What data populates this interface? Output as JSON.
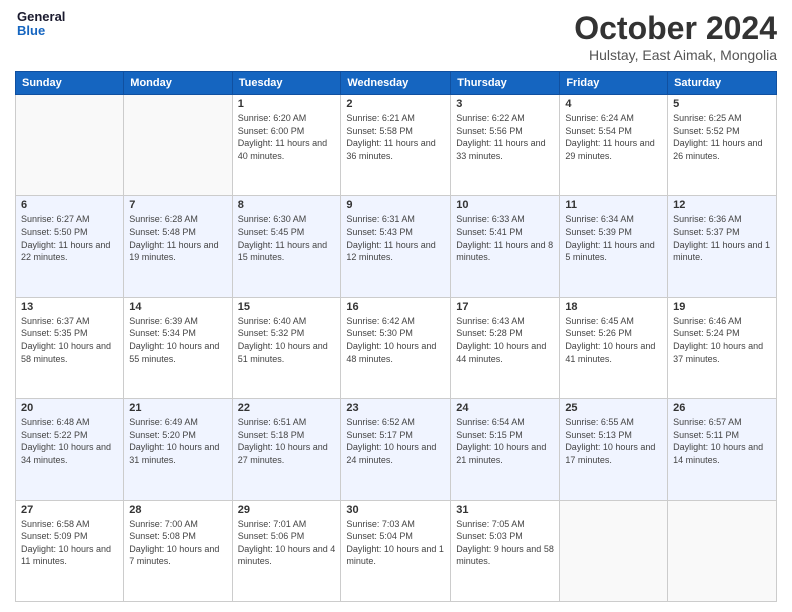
{
  "header": {
    "logo_general": "General",
    "logo_blue": "Blue",
    "month": "October 2024",
    "location": "Hulstay, East Aimak, Mongolia"
  },
  "days_of_week": [
    "Sunday",
    "Monday",
    "Tuesday",
    "Wednesday",
    "Thursday",
    "Friday",
    "Saturday"
  ],
  "weeks": [
    [
      {
        "num": "",
        "info": ""
      },
      {
        "num": "",
        "info": ""
      },
      {
        "num": "1",
        "info": "Sunrise: 6:20 AM\nSunset: 6:00 PM\nDaylight: 11 hours and 40 minutes."
      },
      {
        "num": "2",
        "info": "Sunrise: 6:21 AM\nSunset: 5:58 PM\nDaylight: 11 hours and 36 minutes."
      },
      {
        "num": "3",
        "info": "Sunrise: 6:22 AM\nSunset: 5:56 PM\nDaylight: 11 hours and 33 minutes."
      },
      {
        "num": "4",
        "info": "Sunrise: 6:24 AM\nSunset: 5:54 PM\nDaylight: 11 hours and 29 minutes."
      },
      {
        "num": "5",
        "info": "Sunrise: 6:25 AM\nSunset: 5:52 PM\nDaylight: 11 hours and 26 minutes."
      }
    ],
    [
      {
        "num": "6",
        "info": "Sunrise: 6:27 AM\nSunset: 5:50 PM\nDaylight: 11 hours and 22 minutes."
      },
      {
        "num": "7",
        "info": "Sunrise: 6:28 AM\nSunset: 5:48 PM\nDaylight: 11 hours and 19 minutes."
      },
      {
        "num": "8",
        "info": "Sunrise: 6:30 AM\nSunset: 5:45 PM\nDaylight: 11 hours and 15 minutes."
      },
      {
        "num": "9",
        "info": "Sunrise: 6:31 AM\nSunset: 5:43 PM\nDaylight: 11 hours and 12 minutes."
      },
      {
        "num": "10",
        "info": "Sunrise: 6:33 AM\nSunset: 5:41 PM\nDaylight: 11 hours and 8 minutes."
      },
      {
        "num": "11",
        "info": "Sunrise: 6:34 AM\nSunset: 5:39 PM\nDaylight: 11 hours and 5 minutes."
      },
      {
        "num": "12",
        "info": "Sunrise: 6:36 AM\nSunset: 5:37 PM\nDaylight: 11 hours and 1 minute."
      }
    ],
    [
      {
        "num": "13",
        "info": "Sunrise: 6:37 AM\nSunset: 5:35 PM\nDaylight: 10 hours and 58 minutes."
      },
      {
        "num": "14",
        "info": "Sunrise: 6:39 AM\nSunset: 5:34 PM\nDaylight: 10 hours and 55 minutes."
      },
      {
        "num": "15",
        "info": "Sunrise: 6:40 AM\nSunset: 5:32 PM\nDaylight: 10 hours and 51 minutes."
      },
      {
        "num": "16",
        "info": "Sunrise: 6:42 AM\nSunset: 5:30 PM\nDaylight: 10 hours and 48 minutes."
      },
      {
        "num": "17",
        "info": "Sunrise: 6:43 AM\nSunset: 5:28 PM\nDaylight: 10 hours and 44 minutes."
      },
      {
        "num": "18",
        "info": "Sunrise: 6:45 AM\nSunset: 5:26 PM\nDaylight: 10 hours and 41 minutes."
      },
      {
        "num": "19",
        "info": "Sunrise: 6:46 AM\nSunset: 5:24 PM\nDaylight: 10 hours and 37 minutes."
      }
    ],
    [
      {
        "num": "20",
        "info": "Sunrise: 6:48 AM\nSunset: 5:22 PM\nDaylight: 10 hours and 34 minutes."
      },
      {
        "num": "21",
        "info": "Sunrise: 6:49 AM\nSunset: 5:20 PM\nDaylight: 10 hours and 31 minutes."
      },
      {
        "num": "22",
        "info": "Sunrise: 6:51 AM\nSunset: 5:18 PM\nDaylight: 10 hours and 27 minutes."
      },
      {
        "num": "23",
        "info": "Sunrise: 6:52 AM\nSunset: 5:17 PM\nDaylight: 10 hours and 24 minutes."
      },
      {
        "num": "24",
        "info": "Sunrise: 6:54 AM\nSunset: 5:15 PM\nDaylight: 10 hours and 21 minutes."
      },
      {
        "num": "25",
        "info": "Sunrise: 6:55 AM\nSunset: 5:13 PM\nDaylight: 10 hours and 17 minutes."
      },
      {
        "num": "26",
        "info": "Sunrise: 6:57 AM\nSunset: 5:11 PM\nDaylight: 10 hours and 14 minutes."
      }
    ],
    [
      {
        "num": "27",
        "info": "Sunrise: 6:58 AM\nSunset: 5:09 PM\nDaylight: 10 hours and 11 minutes."
      },
      {
        "num": "28",
        "info": "Sunrise: 7:00 AM\nSunset: 5:08 PM\nDaylight: 10 hours and 7 minutes."
      },
      {
        "num": "29",
        "info": "Sunrise: 7:01 AM\nSunset: 5:06 PM\nDaylight: 10 hours and 4 minutes."
      },
      {
        "num": "30",
        "info": "Sunrise: 7:03 AM\nSunset: 5:04 PM\nDaylight: 10 hours and 1 minute."
      },
      {
        "num": "31",
        "info": "Sunrise: 7:05 AM\nSunset: 5:03 PM\nDaylight: 9 hours and 58 minutes."
      },
      {
        "num": "",
        "info": ""
      },
      {
        "num": "",
        "info": ""
      }
    ]
  ]
}
